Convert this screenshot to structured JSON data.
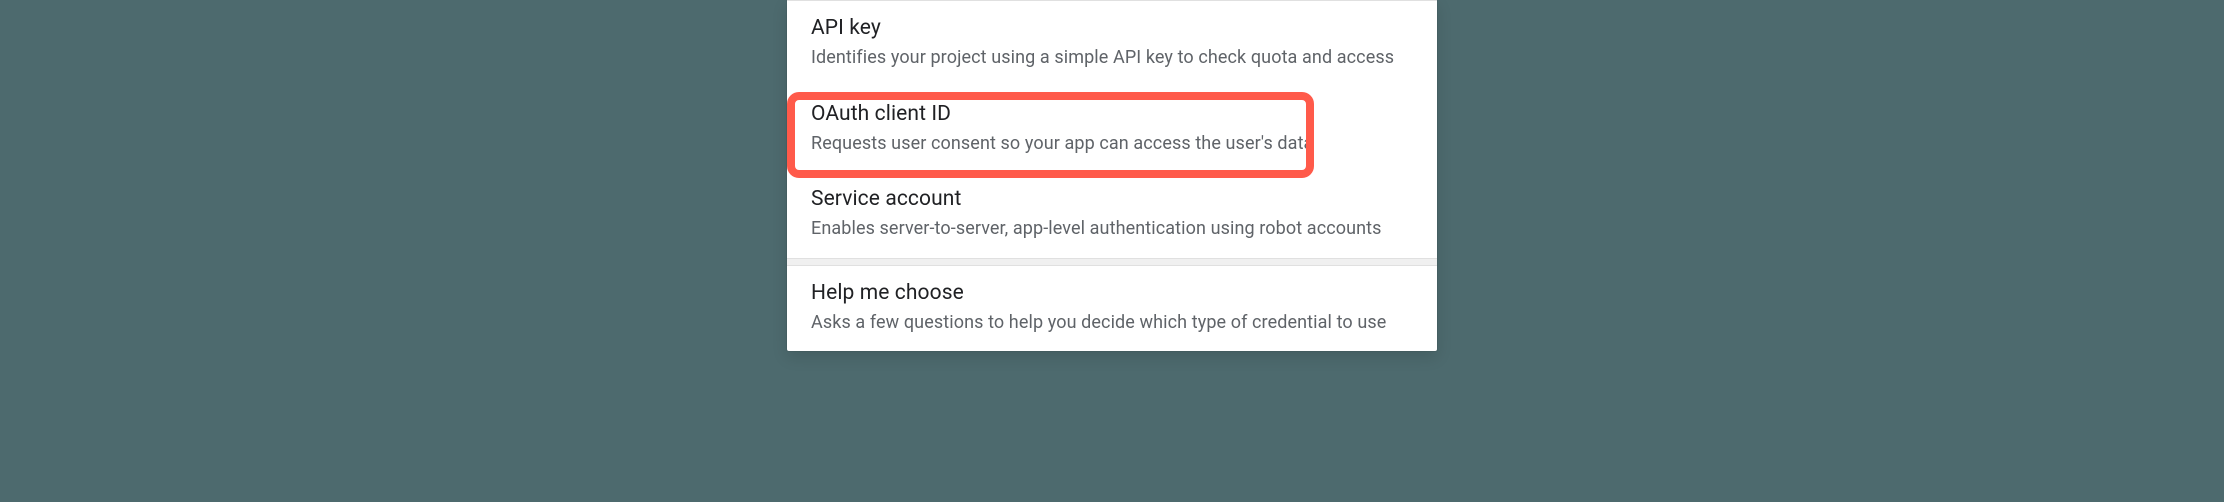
{
  "options": [
    {
      "title": "API key",
      "description": "Identifies your project using a simple API key to check quota and access"
    },
    {
      "title": "OAuth client ID",
      "description": "Requests user consent so your app can access the user's data"
    },
    {
      "title": "Service account",
      "description": "Enables server-to-server, app-level authentication using robot accounts"
    }
  ],
  "help": {
    "title": "Help me choose",
    "description": "Asks a few questions to help you decide which type of credential to use"
  }
}
